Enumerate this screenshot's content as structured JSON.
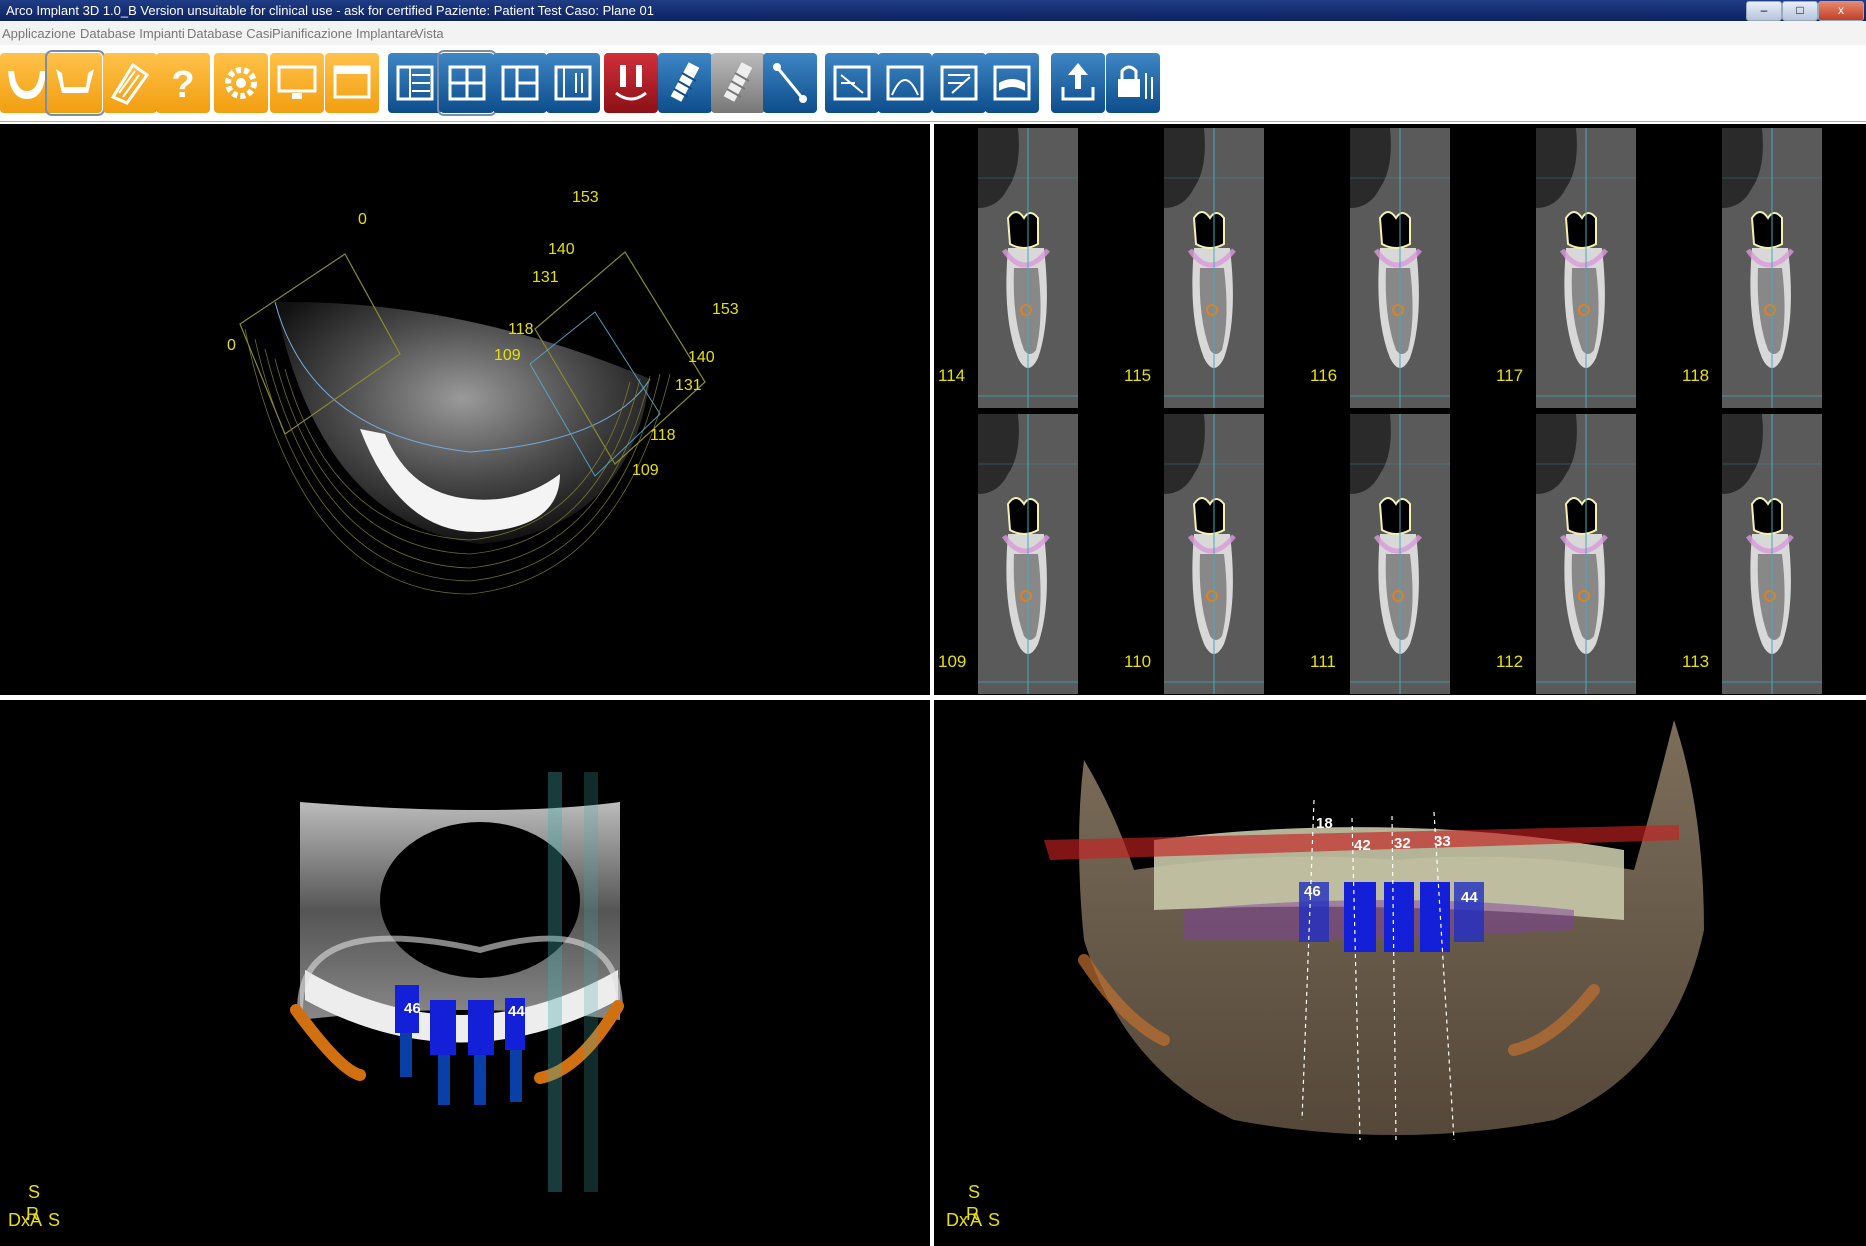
{
  "titlebar": {
    "title": "Arco Implant 3D 1.0_B   Version unsuitable for clinical use - ask for certified     Paziente: Patient Test     Caso: Plane 01",
    "minimize": "–",
    "maximize": "□",
    "close": "x"
  },
  "menu": [
    "Applicazione",
    "Database Impianti",
    "Database Casi",
    "Pianificazione Implantare",
    "Vista"
  ],
  "toolbar": {
    "icons": [
      "arch-icon",
      "jaw-icon",
      "scan-icon",
      "help-icon",
      "settings-icon",
      "monitor-icon",
      "window-icon",
      "layout-list-icon",
      "layout-grid-icon",
      "layout-split-icon",
      "layout-panel-icon",
      "nerve-icon",
      "implant-icon",
      "implant-gray-icon",
      "measure-icon",
      "section-icon",
      "curve-icon",
      "report-icon",
      "plane-icon",
      "export-icon",
      "lock-icon"
    ]
  },
  "axial": {
    "labels": [
      "0",
      "0",
      "153",
      "140",
      "131",
      "118",
      "109",
      "153",
      "140",
      "131",
      "118",
      "109"
    ]
  },
  "sections": {
    "row1": [
      "114",
      "115",
      "116",
      "117",
      "118"
    ],
    "row2": [
      "109",
      "110",
      "111",
      "112",
      "113"
    ]
  },
  "panoramic": {
    "implants": [
      "46",
      "44"
    ],
    "orientation": {
      "top": "S",
      "mid": "R",
      "left": "Dx",
      "a": "A",
      "s": "S"
    }
  },
  "model3d": {
    "implants": [
      "18",
      "42",
      "32",
      "33",
      "46",
      "44"
    ],
    "orientation": {
      "top": "S",
      "mid": "R",
      "left": "Dx",
      "a": "A",
      "s": "S"
    }
  },
  "colors": {
    "accent": "#f29e10",
    "blue": "#0d4d8c",
    "label": "#e8e000"
  }
}
